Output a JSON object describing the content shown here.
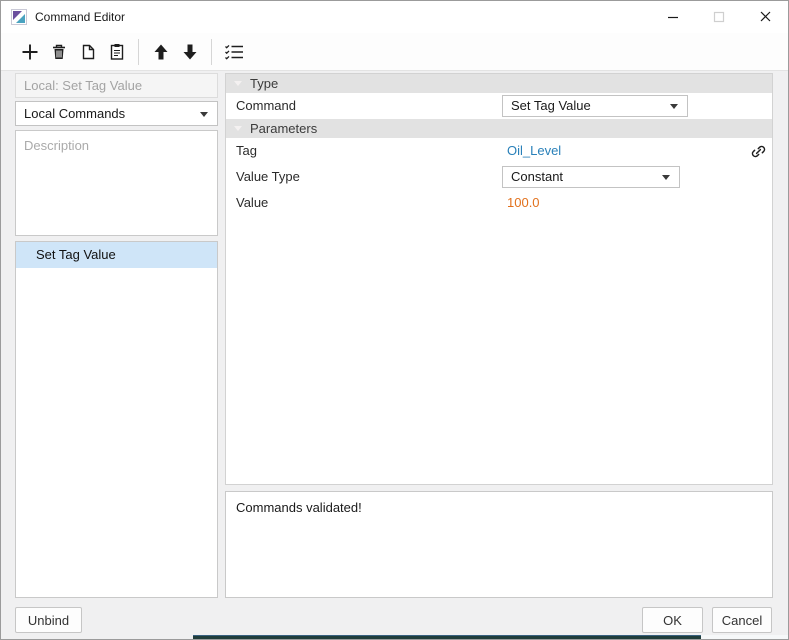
{
  "titlebar": {
    "title": "Command Editor"
  },
  "toolbar": {
    "buttons": [
      "add",
      "delete",
      "copy",
      "paste",
      "move-up",
      "move-down",
      "validate"
    ]
  },
  "left_panel": {
    "binding_field": {
      "value": "Local: Set Tag Value"
    },
    "scope_dropdown": {
      "selected": "Local Commands"
    },
    "description": {
      "placeholder": "Description",
      "value": ""
    },
    "command_list": {
      "items": [
        {
          "label": "Set Tag Value",
          "selected": true
        }
      ]
    }
  },
  "properties": {
    "sections": [
      {
        "title": "Type",
        "rows": [
          {
            "label": "Command",
            "editor": "dropdown",
            "value": "Set Tag Value"
          }
        ]
      },
      {
        "title": "Parameters",
        "rows": [
          {
            "label": "Tag",
            "editor": "tag-link",
            "value": "Oil_Level"
          },
          {
            "label": "Value Type",
            "editor": "dropdown",
            "value": "Constant"
          },
          {
            "label": "Value",
            "editor": "literal",
            "value": "100.0"
          }
        ]
      }
    ]
  },
  "validation": {
    "message": "Commands validated!"
  },
  "footer": {
    "unbind_label": "Unbind",
    "ok_label": "OK",
    "cancel_label": "Cancel"
  },
  "colors": {
    "tag_blue": "#2980b9",
    "value_orange": "#e2711d",
    "selection_blue": "#cfe5f8"
  }
}
